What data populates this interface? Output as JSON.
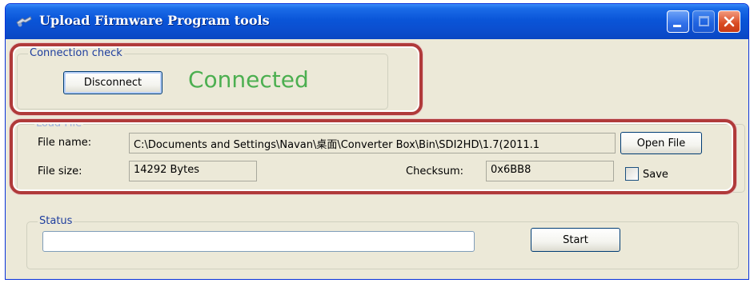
{
  "window": {
    "title": "Upload Firmware Program tools",
    "icons": {
      "app": "app-icon",
      "minimize": "minimize-icon",
      "maximize": "maximize-icon",
      "close": "close-icon"
    }
  },
  "connection": {
    "group_label": "Connection check",
    "disconnect_label": "Disconnect",
    "status_text": "Connected",
    "status_color": "#4caf50"
  },
  "load_file": {
    "group_label": "Load File",
    "file_name_label": "File name:",
    "file_name_value": "C:\\Documents and Settings\\Navan\\桌面\\Converter Box\\Bin\\SDI2HD\\1.7(2011.1",
    "open_file_label": "Open File",
    "file_size_label": "File size:",
    "file_size_value": "14292 Bytes",
    "checksum_label": "Checksum:",
    "checksum_value": "0x6BB8",
    "save_label": "Save",
    "save_checked": false
  },
  "status": {
    "group_label": "Status",
    "progress_value": "",
    "start_label": "Start"
  },
  "highlight_color": "#b03a3a"
}
